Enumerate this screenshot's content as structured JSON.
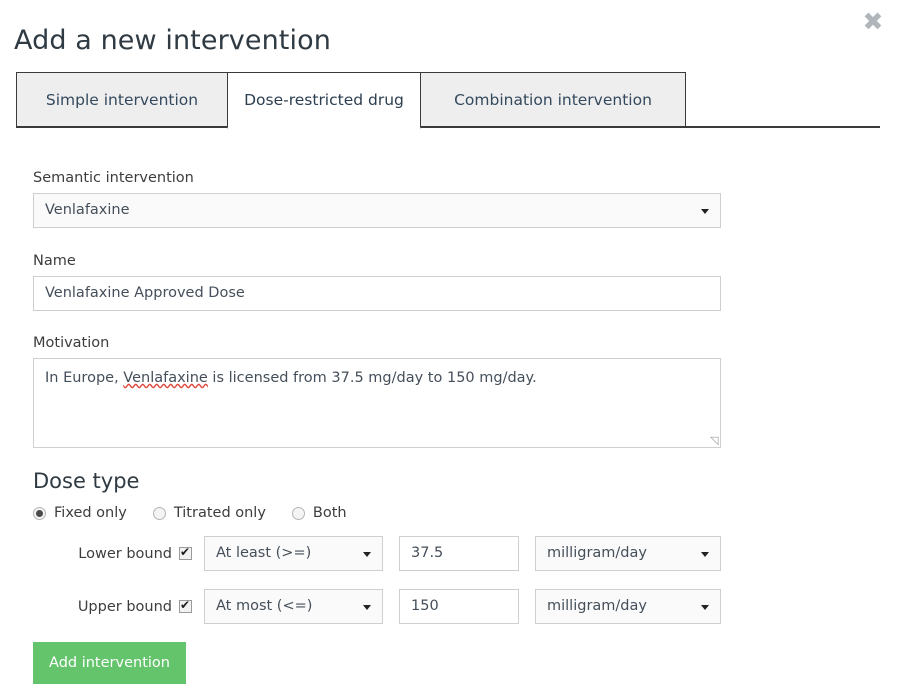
{
  "modal": {
    "title": "Add a new intervention",
    "close_icon": "close-icon",
    "close_glyph": "✖"
  },
  "tabs": [
    {
      "label": "Simple intervention",
      "active": false
    },
    {
      "label": "Dose-restricted drug",
      "active": true
    },
    {
      "label": "Combination intervention",
      "active": false
    }
  ],
  "form": {
    "semantic_intervention": {
      "label": "Semantic intervention",
      "value": "Venlafaxine"
    },
    "name": {
      "label": "Name",
      "value": "Venlafaxine Approved Dose"
    },
    "motivation": {
      "label": "Motivation",
      "value": "In Europe, Venlafaxine is licensed from 37.5 mg/day to 150 mg/day.",
      "misspelled_word": "Venlafaxine",
      "text_before": "In Europe, ",
      "text_after": " is licensed from 37.5 mg/day to 150 mg/day."
    }
  },
  "dose_type": {
    "title": "Dose type",
    "options": [
      {
        "label": "Fixed only",
        "selected": true
      },
      {
        "label": "Titrated only",
        "selected": false
      },
      {
        "label": "Both",
        "selected": false
      }
    ],
    "bounds": [
      {
        "label": "Lower bound",
        "enabled": true,
        "operator": "At least (>=)",
        "amount": "37.5",
        "unit": "milligram/day"
      },
      {
        "label": "Upper bound",
        "enabled": true,
        "operator": "At most (<=)",
        "amount": "150",
        "unit": "milligram/day"
      }
    ]
  },
  "actions": {
    "submit_label": "Add intervention",
    "submit_color": "#63c46b"
  }
}
